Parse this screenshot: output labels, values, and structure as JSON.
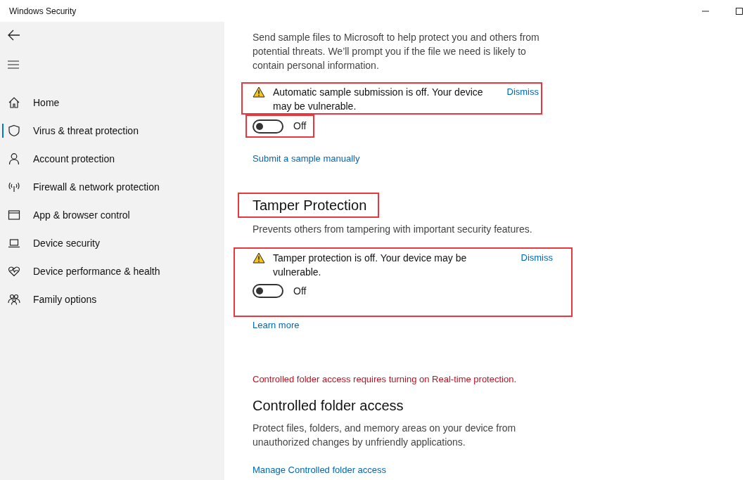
{
  "window": {
    "title": "Windows Security"
  },
  "sidebar": {
    "items": [
      {
        "label": "Home",
        "selected": false
      },
      {
        "label": "Virus & threat protection",
        "selected": true
      },
      {
        "label": "Account protection",
        "selected": false
      },
      {
        "label": "Firewall & network protection",
        "selected": false
      },
      {
        "label": "App & browser control",
        "selected": false
      },
      {
        "label": "Device security",
        "selected": false
      },
      {
        "label": "Device performance & health",
        "selected": false
      },
      {
        "label": "Family options",
        "selected": false
      }
    ]
  },
  "sections": [
    {
      "description": "Send sample files to Microsoft to help protect you and others from potential threats. We’ll prompt you if the file we need is likely to contain personal information.",
      "warning": {
        "text": "Automatic sample submission is off. Your device may be vulnerable.",
        "dismiss": "Dismiss",
        "highlighted": true
      },
      "toggle": {
        "on": false,
        "label": "Off",
        "highlighted": true
      },
      "link": "Submit a sample manually"
    },
    {
      "heading": {
        "text": "Tamper Protection",
        "highlighted": true
      },
      "description": "Prevents others from tampering with important security features.",
      "warning": {
        "text": "Tamper protection is off. Your device may be vulnerable.",
        "dismiss": "Dismiss",
        "highlighted": true,
        "toggle": {
          "on": false,
          "label": "Off"
        }
      },
      "link": "Learn more"
    },
    {
      "error": "Controlled folder access requires turning on Real-time protection.",
      "heading": {
        "text": "Controlled folder access",
        "highlighted": false
      },
      "description": "Protect files, folders, and memory areas on your device from unauthorized changes by unfriendly applications.",
      "link": "Manage Controlled folder access"
    }
  ]
}
